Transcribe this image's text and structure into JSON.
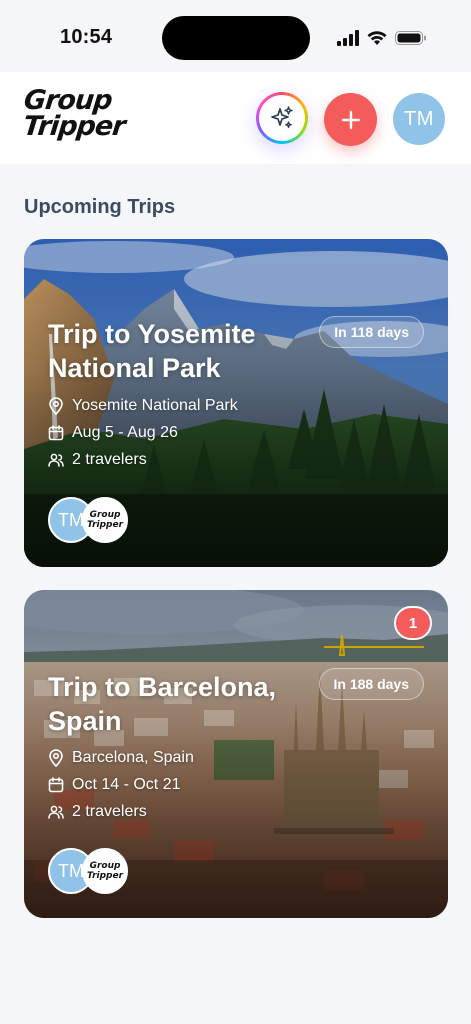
{
  "status_bar": {
    "time": "10:54"
  },
  "header": {
    "logo_line1": "Group",
    "logo_line2": "Tripper",
    "avatar_initials": "TM"
  },
  "section_title": "Upcoming Trips",
  "trips": [
    {
      "title": "Trip to Yosemite National Park",
      "days_badge": "In 118 days",
      "location": "Yosemite National Park",
      "dates": "Aug 5 - Aug 26",
      "travelers": "2 travelers",
      "traveler_initials": "TM",
      "traveler_logo_line1": "Group",
      "traveler_logo_line2": "Tripper"
    },
    {
      "title": "Trip to Barcelona, Spain",
      "days_badge": "In 188 days",
      "location": "Barcelona, Spain",
      "dates": "Oct 14 - Oct 21",
      "travelers": "2 travelers",
      "traveler_initials": "TM",
      "traveler_logo_line1": "Group",
      "traveler_logo_line2": "Tripper",
      "notification_count": "1"
    }
  ],
  "colors": {
    "accent_red": "#f45b5b",
    "avatar_blue": "#8fc3e8",
    "section_title": "#3a4b63"
  },
  "icons": [
    "sparkles-icon",
    "plus-icon",
    "map-pin-icon",
    "calendar-icon",
    "users-icon",
    "signal-icon",
    "wifi-icon",
    "battery-icon"
  ]
}
